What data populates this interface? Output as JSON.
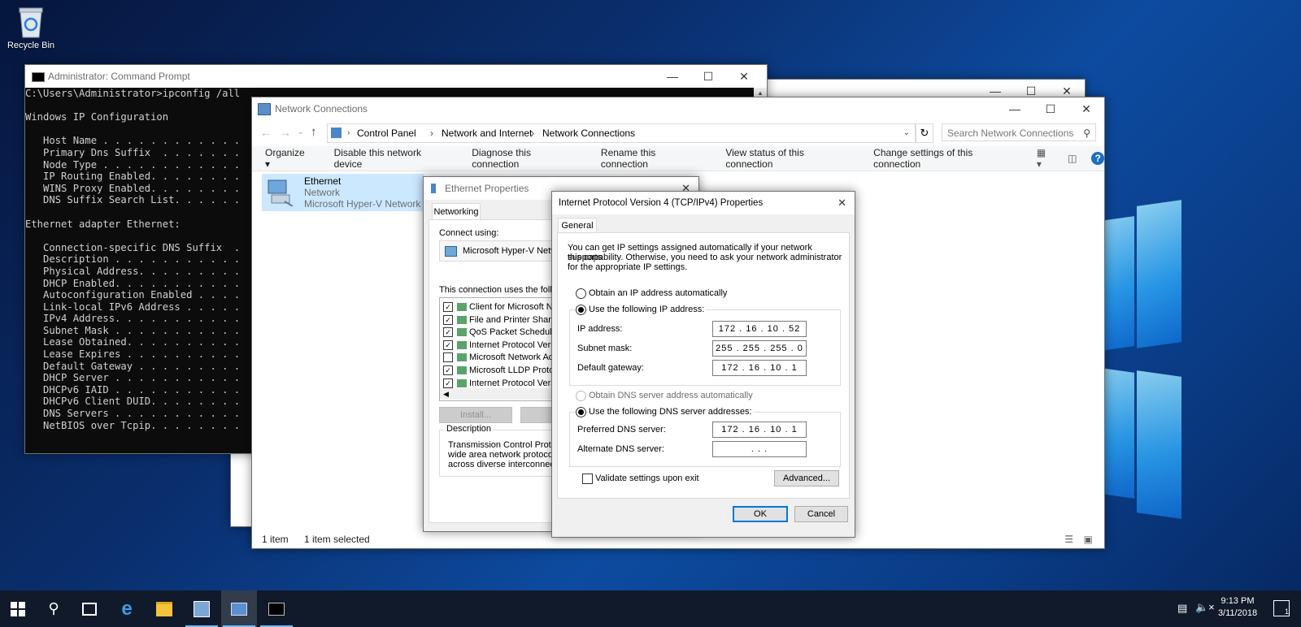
{
  "desktop": {
    "recycle_bin": "Recycle Bin"
  },
  "cmd": {
    "title": "Administrator: Command Prompt",
    "lines": [
      "C:\\Users\\Administrator>ipconfig /all",
      "",
      "Windows IP Configuration",
      "",
      "   Host Name . . . . . . . . . . . .",
      "   Primary Dns Suffix  . . . . . . .",
      "   Node Type . . . . . . . . . . . .",
      "   IP Routing Enabled. . . . . . . .",
      "   WINS Proxy Enabled. . . . . . . .",
      "   DNS Suffix Search List. . . . . .",
      "",
      "Ethernet adapter Ethernet:",
      "",
      "   Connection-specific DNS Suffix  .",
      "   Description . . . . . . . . . . .",
      "   Physical Address. . . . . . . . .",
      "   DHCP Enabled. . . . . . . . . . .",
      "   Autoconfiguration Enabled . . . .",
      "   Link-local IPv6 Address . . . . .",
      "   IPv4 Address. . . . . . . . . . .",
      "   Subnet Mask . . . . . . . . . . .",
      "   Lease Obtained. . . . . . . . . .",
      "   Lease Expires . . . . . . . . . .",
      "   Default Gateway . . . . . . . . .",
      "   DHCP Server . . . . . . . . . . .",
      "   DHCPv6 IAID . . . . . . . . . . .",
      "   DHCPv6 Client DUID. . . . . . . .",
      "   DNS Servers . . . . . . . . . . .",
      "   NetBIOS over Tcpip. . . . . . . ."
    ]
  },
  "explorer": {
    "title": "Network Connections",
    "breadcrumb": [
      "Control Panel",
      "Network and Internet",
      "Network Connections"
    ],
    "search_placeholder": "Search Network Connections",
    "commands": [
      "Organize ▾",
      "Disable this network device",
      "Diagnose this connection",
      "Rename this connection",
      "View status of this connection",
      "Change settings of this connection"
    ],
    "item": {
      "name": "Ethernet",
      "status": "Network",
      "device": "Microsoft Hyper-V Network A"
    },
    "status_count": "1 item",
    "status_selected": "1 item selected"
  },
  "eth_props": {
    "title": "Ethernet Properties",
    "tab": "Networking",
    "connect_using_label": "Connect using:",
    "adapter": "Microsoft Hyper-V Netwo",
    "items_label": "This connection uses the follow",
    "items": [
      {
        "label": "Client for Microsoft Ne",
        "checked": true
      },
      {
        "label": "File and Printer Sharin",
        "checked": true
      },
      {
        "label": "QoS Packet Schedule",
        "checked": true
      },
      {
        "label": "Internet Protocol Versi",
        "checked": true
      },
      {
        "label": "Microsoft Network Ada",
        "checked": false
      },
      {
        "label": "Microsoft LLDP Protoc",
        "checked": true
      },
      {
        "label": "Internet Protocol Versi",
        "checked": true
      }
    ],
    "install_label": "Install...",
    "uninstall_label": "U",
    "description_label": "Description",
    "description_text": [
      "Transmission Control Protoco",
      "wide area network protocol t",
      "across diverse interconnecte"
    ]
  },
  "ipv4": {
    "title": "Internet Protocol Version 4 (TCP/IPv4) Properties",
    "tab": "General",
    "intro": [
      "You can get IP settings assigned automatically if your network supports",
      "this capability. Otherwise, you need to ask your network administrator",
      "for the appropriate IP settings."
    ],
    "obtain_ip_auto": "Obtain an IP address automatically",
    "use_following_ip": "Use the following IP address:",
    "ip_address_label": "IP address:",
    "ip_address": "172  .  16  .  10  .  52",
    "subnet_label": "Subnet mask:",
    "subnet": "255 . 255 . 255 .  0",
    "gateway_label": "Default gateway:",
    "gateway": "172  .  16  .  10  .  1",
    "obtain_dns_auto": "Obtain DNS server address automatically",
    "use_following_dns": "Use the following DNS server addresses:",
    "pref_dns_label": "Preferred DNS server:",
    "pref_dns": "172  .  16  .  10  .  1",
    "alt_dns_label": "Alternate DNS server:",
    "alt_dns": ".     .     .",
    "validate_label": "Validate settings upon exit",
    "advanced_label": "Advanced...",
    "ok_label": "OK",
    "cancel_label": "Cancel"
  },
  "taskbar": {
    "time": "9:13 PM",
    "date": "3/11/2018",
    "notification_count": "1"
  }
}
